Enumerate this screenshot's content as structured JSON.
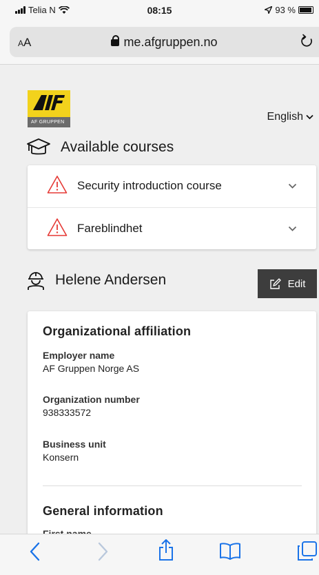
{
  "status_bar": {
    "carrier": "Telia N",
    "time": "08:15",
    "battery_text": "93 %"
  },
  "browser": {
    "text_size_label": "AA",
    "url": "me.afgruppen.no"
  },
  "header": {
    "logo_text": "AF GRUPPEN",
    "language": "English"
  },
  "courses": {
    "title": "Available courses",
    "items": [
      {
        "label": "Security introduction course"
      },
      {
        "label": "Fareblindhet"
      }
    ]
  },
  "profile": {
    "name": "Helene Andersen",
    "edit_label": "Edit",
    "org_section_title": "Organizational affiliation",
    "fields": [
      {
        "label": "Employer name",
        "value": "AF Gruppen Norge AS"
      },
      {
        "label": "Organization number",
        "value": "938333572"
      },
      {
        "label": "Business unit",
        "value": "Konsern"
      }
    ],
    "general_section_title": "General information",
    "first_name_label": "First name"
  },
  "colors": {
    "logo_yellow": "#f2d21c",
    "warning_red": "#e53935",
    "edit_button_bg": "#3d3d3d",
    "ios_blue": "#1a73e8"
  }
}
